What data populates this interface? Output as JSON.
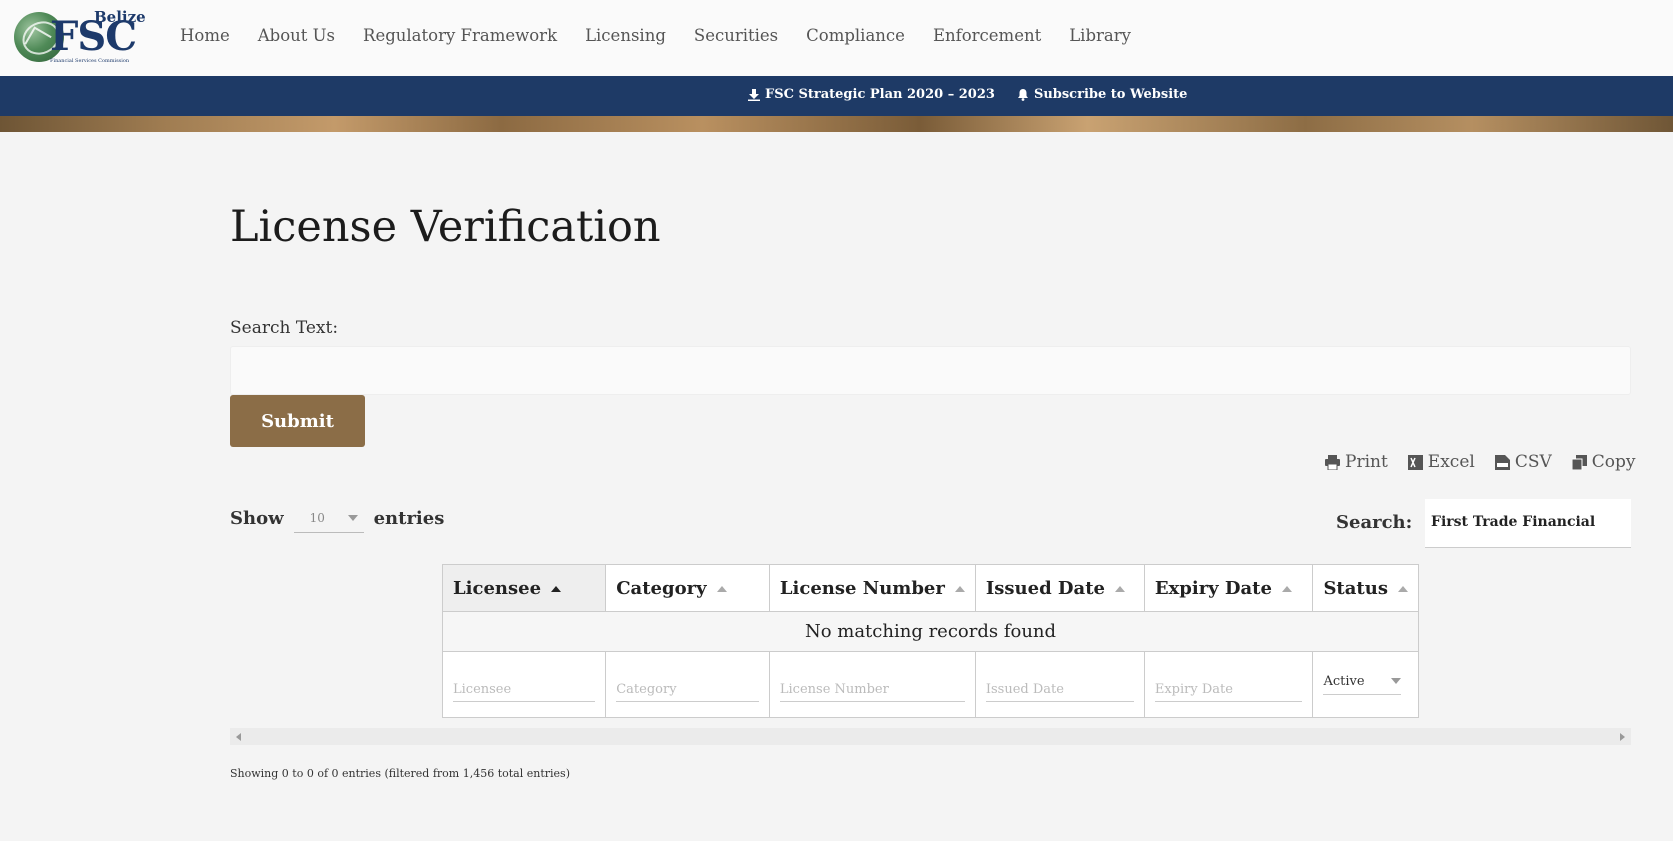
{
  "brand": {
    "top": "Belize",
    "main": "FSC",
    "sub": "Financial Services Commission"
  },
  "nav": [
    "Home",
    "About Us",
    "Regulatory Framework",
    "Licensing",
    "Securities",
    "Compliance",
    "Enforcement",
    "Library"
  ],
  "bluebar": {
    "strategic_plan": "FSC Strategic Plan 2020 – 2023",
    "subscribe": "Subscribe to Website"
  },
  "page": {
    "title": "License Verification",
    "search_label": "Search Text:",
    "search_value": "",
    "submit_label": "Submit"
  },
  "exports": {
    "print": "Print",
    "excel": "Excel",
    "csv": "CSV",
    "copy": "Copy"
  },
  "length": {
    "show": "Show",
    "value": "10",
    "entries": "entries"
  },
  "table_search": {
    "label": "Search:",
    "value": "First Trade Financial"
  },
  "table": {
    "columns": [
      "Licensee",
      "Category",
      "License Number",
      "Issued Date",
      "Expiry Date",
      "Status"
    ],
    "empty_message": "No matching records found",
    "filters": [
      "Licensee",
      "Category",
      "License Number",
      "Issued Date",
      "Expiry Date"
    ],
    "status_filter": "Active"
  },
  "info": "Showing 0 to 0 of 0 entries (filtered from 1,456 total entries)",
  "colors": {
    "navy": "#1e3a66",
    "submit": "#8b6d47"
  },
  "icons": [
    "download-icon",
    "bell-icon",
    "print-icon",
    "excel-icon",
    "csv-icon",
    "copy-icon"
  ]
}
